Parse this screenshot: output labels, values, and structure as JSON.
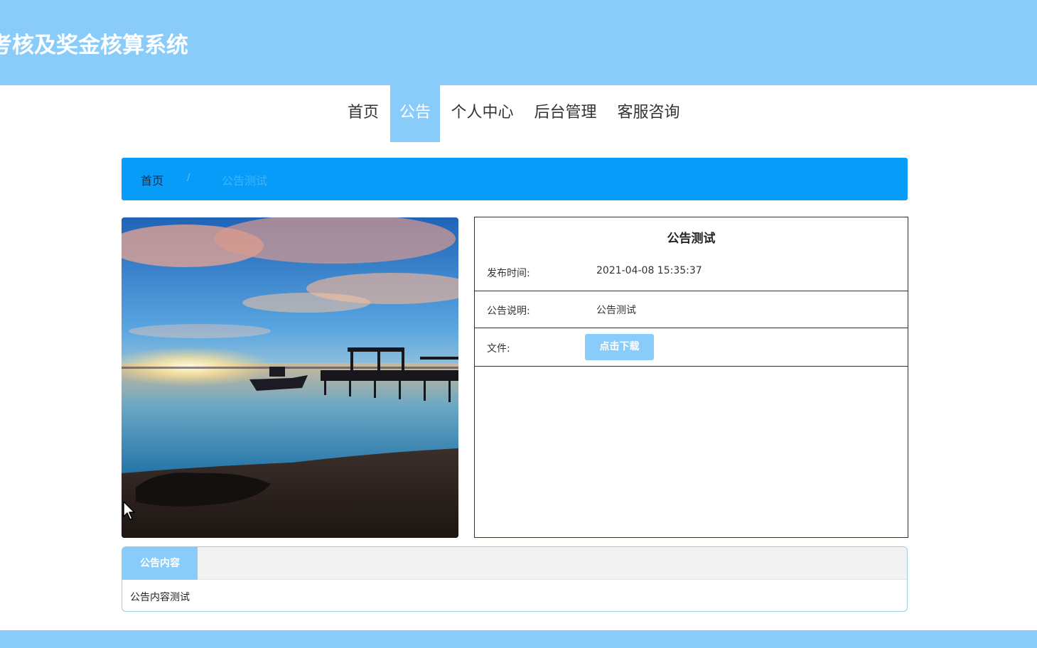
{
  "header": {
    "title": "考核及奖金核算系统"
  },
  "nav": {
    "items": [
      {
        "label": "首页",
        "active": false
      },
      {
        "label": "公告",
        "active": true
      },
      {
        "label": "个人中心",
        "active": false
      },
      {
        "label": "后台管理",
        "active": false
      },
      {
        "label": "客服咨询",
        "active": false
      }
    ]
  },
  "breadcrumb": {
    "home": "首页",
    "separator": "/",
    "current": "公告测试"
  },
  "detail": {
    "title": "公告测试",
    "publish_time_label": "发布时间:",
    "publish_time": "2021-04-08 15:35:37",
    "description_label": "公告说明:",
    "description": "公告测试",
    "file_label": "文件:",
    "download_button": "点击下载"
  },
  "content": {
    "tab_label": "公告内容",
    "text": "公告内容测试"
  },
  "colors": {
    "header": "#89ccf9",
    "breadcrumb": "#079cf7",
    "border": "#3a2d22"
  }
}
